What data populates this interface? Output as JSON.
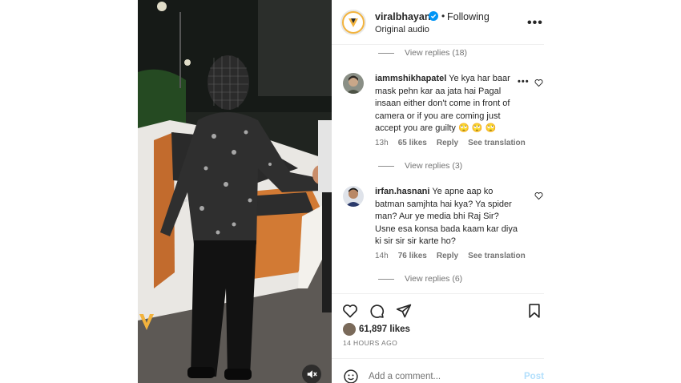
{
  "header": {
    "username": "viralbhayani",
    "separator": "•",
    "follow_state": "Following",
    "subtitle": "Original audio",
    "more_icon": "more-horizontal-icon",
    "verified_icon": "verified-badge-icon",
    "verified_color": "#0095f6"
  },
  "comments": [
    {
      "replies_label": "View replies (18)"
    },
    {
      "username": "iammshikhapatel",
      "text": "Ye kya har baar mask pehn kar aa jata hai Pagal insaan either don't come in front of camera or if you are coming just accept you are guilty 🙄 🙄 🙄",
      "time": "13h",
      "likes": "65 likes",
      "reply": "Reply",
      "translate": "See translation",
      "replies_label": "View replies (3)"
    },
    {
      "username": "irfan.hasnani",
      "text": "Ye apne aap ko batman samjhta hai kya? Ya spider man? Aur ye media bhi Raj Sir? Usne esa konsa bada kaam kar diya ki sir sir sir karte ho?",
      "time": "14h",
      "likes": "76 likes",
      "reply": "Reply",
      "translate": "See translation",
      "replies_label": "View replies (6)"
    }
  ],
  "actions": {
    "icons": [
      "heart-icon",
      "comment-icon",
      "share-icon",
      "bookmark-icon"
    ],
    "likes": "61,897 likes",
    "time_ago": "14 HOURS AGO"
  },
  "composer": {
    "placeholder": "Add a comment...",
    "post_label": "Post",
    "post_color": "#b2dffc"
  },
  "media": {
    "mute_icon": "muted-speaker-icon",
    "watermark_icon": "viral-bhayani-logo"
  }
}
